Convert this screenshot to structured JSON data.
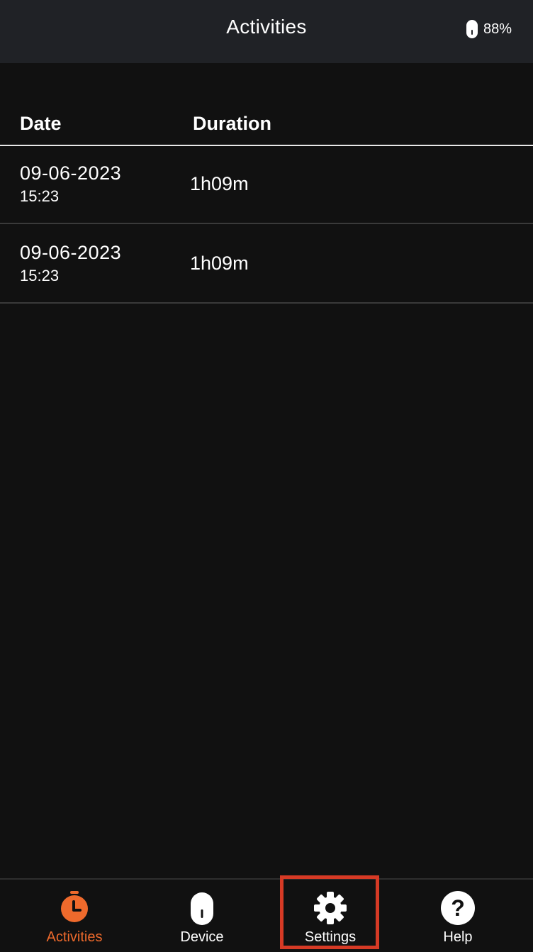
{
  "header": {
    "title": "Activities",
    "battery_text": "88%",
    "battery_icon": "device-battery-icon"
  },
  "table": {
    "columns": [
      "Date",
      "Duration"
    ],
    "rows": [
      {
        "date": "09-06-2023",
        "time": "15:23",
        "duration": "1h09m"
      },
      {
        "date": "09-06-2023",
        "time": "15:23",
        "duration": "1h09m"
      }
    ]
  },
  "tabs": [
    {
      "label": "Activities",
      "icon": "stopwatch-icon",
      "active": true
    },
    {
      "label": "Device",
      "icon": "device-icon",
      "active": false
    },
    {
      "label": "Settings",
      "icon": "gear-icon",
      "active": false
    },
    {
      "label": "Help",
      "icon": "help-icon",
      "active": false
    }
  ],
  "colors": {
    "accent": "#ef6a2c",
    "background": "#111111",
    "header_background": "#202226",
    "highlight": "#d63a25"
  }
}
